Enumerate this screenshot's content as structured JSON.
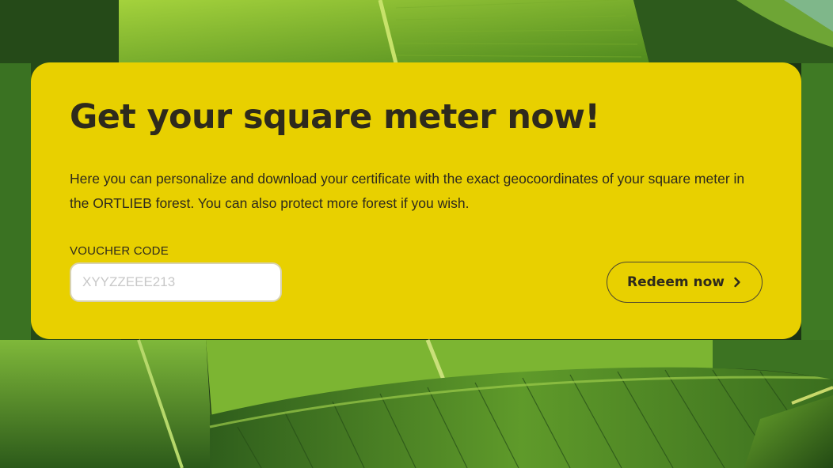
{
  "card": {
    "headline": "Get your square meter now!",
    "description": "Here you can personalize and download your certificate with the exact geocoordinates of your square meter in the ORTLIEB forest. You can also protect more forest if you wish.",
    "voucher_label": "VOUCHER CODE",
    "voucher_input": {
      "value": "",
      "placeholder": "XYYZZEEE213"
    },
    "redeem_button_label": "Redeem now"
  },
  "icons": {
    "redeem_chevron": "chevron-right-icon"
  },
  "colors": {
    "card_background": "#e8d000",
    "text": "#2e2a1c",
    "input_background": "#ffffff",
    "foliage_dark": "#1f3d17",
    "foliage_light": "#8fc832"
  }
}
